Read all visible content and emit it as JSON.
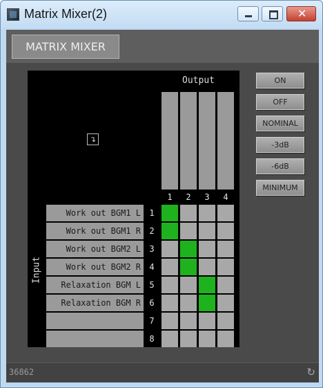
{
  "window": {
    "title": "Matrix Mixer(2)"
  },
  "panel": {
    "tab_label": "MATRIX MIXER"
  },
  "matrix": {
    "corner_icon": "↴",
    "output_label": "Output",
    "input_label": "Input",
    "outputs": [
      "1",
      "2",
      "3",
      "4"
    ],
    "inputs": [
      {
        "number": "1",
        "label": "Work out BGM1 L"
      },
      {
        "number": "2",
        "label": "Work out BGM1 R"
      },
      {
        "number": "3",
        "label": "Work out BGM2 L"
      },
      {
        "number": "4",
        "label": "Work out BGM2 R"
      },
      {
        "number": "5",
        "label": "Relaxation BGM L"
      },
      {
        "number": "6",
        "label": "Relaxation BGM R"
      },
      {
        "number": "7",
        "label": ""
      },
      {
        "number": "8",
        "label": ""
      }
    ],
    "routing": [
      [
        true,
        false,
        false,
        false
      ],
      [
        true,
        false,
        false,
        false
      ],
      [
        false,
        true,
        false,
        false
      ],
      [
        false,
        true,
        false,
        false
      ],
      [
        false,
        false,
        true,
        false
      ],
      [
        false,
        false,
        true,
        false
      ],
      [
        false,
        false,
        false,
        false
      ],
      [
        false,
        false,
        false,
        false
      ]
    ],
    "on_color": "#1eb31e",
    "off_color": "#a8a8a8"
  },
  "buttons": [
    {
      "name": "on-button",
      "label": "ON"
    },
    {
      "name": "off-button",
      "label": "OFF"
    },
    {
      "name": "nominal-button",
      "label": "NOMINAL"
    },
    {
      "name": "minus-3db-button",
      "label": "-3dB"
    },
    {
      "name": "minus-6db-button",
      "label": "-6dB"
    },
    {
      "name": "minimum-button",
      "label": "MINIMUM"
    }
  ],
  "status": {
    "id": "36862",
    "refresh_icon": "↻"
  }
}
